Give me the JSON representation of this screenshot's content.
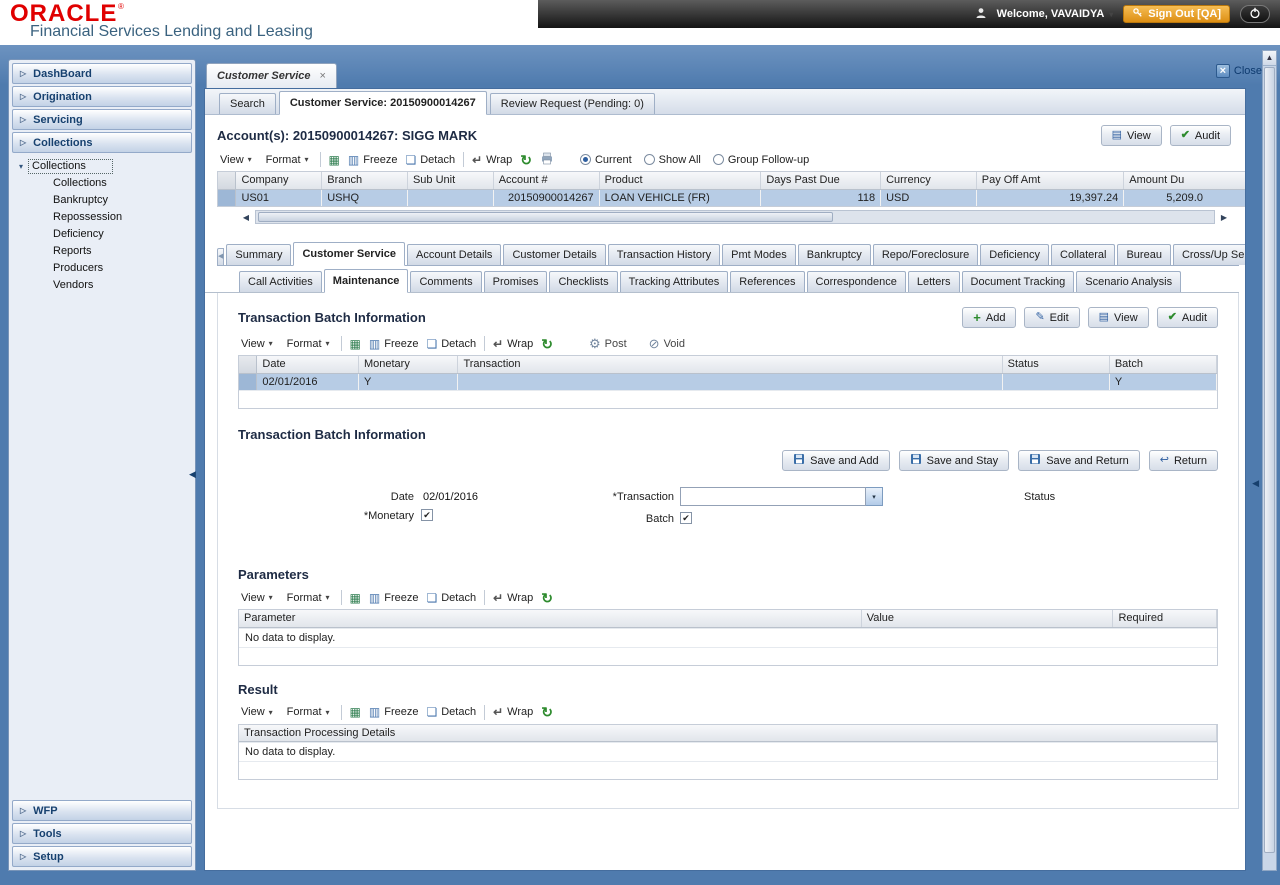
{
  "branding": {
    "logo": "ORACLE",
    "registered": "®",
    "product_name": "Financial Services Lending and Leasing"
  },
  "session": {
    "welcome": "Welcome, VAVAIDYA",
    "sign_out": "Sign Out [QA]"
  },
  "sidebar": {
    "items": [
      {
        "label": "DashBoard"
      },
      {
        "label": "Origination"
      },
      {
        "label": "Servicing"
      },
      {
        "label": "Collections"
      }
    ],
    "tree_root": "Collections",
    "tree_items": [
      {
        "label": "Collections"
      },
      {
        "label": "Bankruptcy"
      },
      {
        "label": "Repossession"
      },
      {
        "label": "Deficiency"
      },
      {
        "label": "Reports"
      },
      {
        "label": "Producers"
      },
      {
        "label": "Vendors"
      }
    ],
    "bottom_items": [
      {
        "label": "WFP"
      },
      {
        "label": "Tools"
      },
      {
        "label": "Setup"
      }
    ]
  },
  "workspace": {
    "tab": "Customer Service",
    "close": "Close"
  },
  "page_tabs": [
    {
      "label": "Search"
    },
    {
      "label": "Customer Service: 20150900014267"
    },
    {
      "label": "Review Request (Pending: 0)"
    }
  ],
  "toolbar": {
    "view": "View",
    "format": "Format",
    "freeze": "Freeze",
    "detach": "Detach",
    "wrap": "Wrap"
  },
  "account": {
    "title": "Account(s): 20150900014267: SIGG MARK",
    "view_button": "View",
    "audit_button": "Audit",
    "filters": [
      {
        "label": "Current",
        "selected": true
      },
      {
        "label": "Show All",
        "selected": false
      },
      {
        "label": "Group Follow-up",
        "selected": false
      }
    ],
    "columns": [
      "Company",
      "Branch",
      "Sub Unit",
      "Account #",
      "Product",
      "Days Past Due",
      "Currency",
      "Pay Off Amt",
      "Amount Du"
    ],
    "row": {
      "company": "US01",
      "branch": "USHQ",
      "sub_unit": "",
      "account_number": "20150900014267",
      "product": "LOAN VEHICLE (FR)",
      "days_past_due": "118",
      "currency": "USD",
      "pay_off_amt": "19,397.24",
      "amount_due": "5,209.0"
    }
  },
  "detail_tabs": [
    {
      "label": "Summary"
    },
    {
      "label": "Customer Service"
    },
    {
      "label": "Account Details"
    },
    {
      "label": "Customer Details"
    },
    {
      "label": "Transaction History"
    },
    {
      "label": "Pmt Modes"
    },
    {
      "label": "Bankruptcy"
    },
    {
      "label": "Repo/Foreclosure"
    },
    {
      "label": "Deficiency"
    },
    {
      "label": "Collateral"
    },
    {
      "label": "Bureau"
    },
    {
      "label": "Cross/Up Se"
    }
  ],
  "sub_tabs": [
    {
      "label": "Call Activities"
    },
    {
      "label": "Maintenance"
    },
    {
      "label": "Comments"
    },
    {
      "label": "Promises"
    },
    {
      "label": "Checklists"
    },
    {
      "label": "Tracking Attributes"
    },
    {
      "label": "References"
    },
    {
      "label": "Correspondence"
    },
    {
      "label": "Letters"
    },
    {
      "label": "Document Tracking"
    },
    {
      "label": "Scenario Analysis"
    }
  ],
  "batch_grid": {
    "title": "Transaction Batch Information",
    "add_button": "Add",
    "edit_button": "Edit",
    "view_button": "View",
    "audit_button": "Audit",
    "post_button": "Post",
    "void_button": "Void",
    "columns": [
      "Date",
      "Monetary",
      "Transaction",
      "Status",
      "Batch"
    ],
    "row": {
      "date": "02/01/2016",
      "monetary": "Y",
      "transaction": "",
      "status": "",
      "batch": "Y"
    }
  },
  "batch_form": {
    "title": "Transaction Batch Information",
    "save_and_add": "Save and Add",
    "save_and_stay": "Save and Stay",
    "save_and_return": "Save and Return",
    "return_button": "Return",
    "required_marker": "*",
    "date_label": "Date",
    "date_value": "02/01/2016",
    "monetary_label": "Monetary",
    "transaction_label": "Transaction",
    "batch_label": "Batch",
    "status_label": "Status"
  },
  "parameters": {
    "title": "Parameters",
    "columns": [
      "Parameter",
      "Value",
      "Required"
    ],
    "empty_text": "No data to display."
  },
  "result": {
    "title": "Result",
    "columns": [
      "Transaction Processing Details"
    ],
    "empty_text": "No data to display."
  },
  "icons": {
    "caret_down": "▾",
    "accordion_arrow": "▷",
    "tree_expanded": "▾",
    "tab_close": "×",
    "close_x": "×",
    "export": "▦",
    "freeze": "▥",
    "detach": "❏",
    "wrap": "↵",
    "refresh": "↻",
    "post": "⚙",
    "void": "⊘",
    "add": "+",
    "edit": "✎",
    "view": "▤",
    "audit": "✔",
    "check": "✔",
    "return": "↩",
    "scroll_left": "◀",
    "scroll_right": "▶",
    "scroll_up": "▲",
    "collapse_left": "◀"
  },
  "colors": {
    "oracle_red": "#e00000",
    "frame_blue": "#4f7bae",
    "selected_row": "#b7cce5",
    "accent_navy": "#17416f",
    "signout_orange": "#dd8f14"
  }
}
